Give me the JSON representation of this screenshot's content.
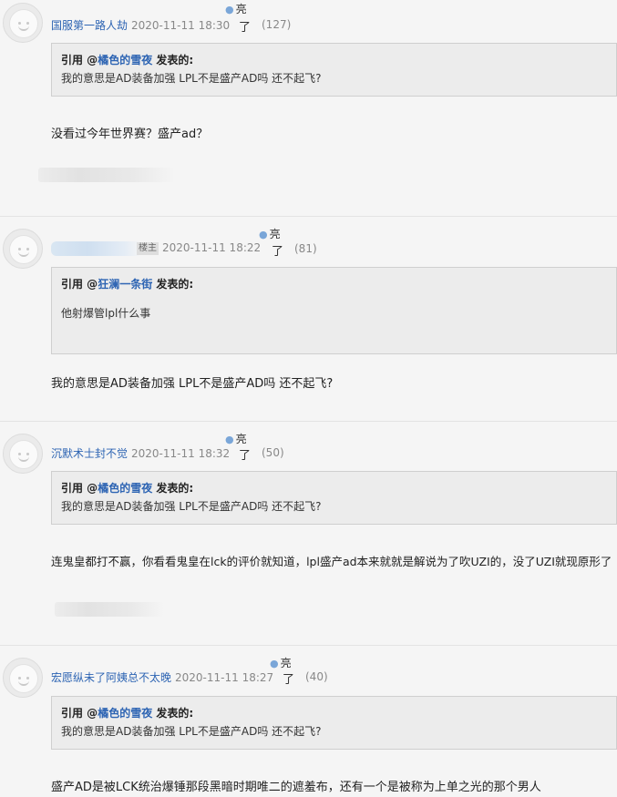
{
  "posts": [
    {
      "author": "国服第一路人劫",
      "time": "2020-11-11 18:30",
      "liang": "亮",
      "liao": "了",
      "count": "(127)",
      "quote": {
        "prefix": "引用 @",
        "user": "橘色的雪夜",
        "suffix": " 发表的:",
        "text": "我的意思是AD装备加强 LPL不是盛产AD吗 还不起飞?"
      },
      "content": "没看过今年世界赛？盛产ad？"
    },
    {
      "author": "",
      "badge": "楼主",
      "time": "2020-11-11 18:22",
      "liang": "亮",
      "liao": "了",
      "count": "(81)",
      "quote": {
        "prefix": "引用 @",
        "user": "狂澜一条街",
        "suffix": " 发表的:",
        "text": "他射爆管lpl什么事"
      },
      "content": "我的意思是AD装备加强 LPL不是盛产AD吗 还不起飞?"
    },
    {
      "author": "沉默术士封不觉",
      "time": "2020-11-11 18:32",
      "liang": "亮",
      "liao": "了",
      "count": "(50)",
      "quote": {
        "prefix": "引用 @",
        "user": "橘色的雪夜",
        "suffix": " 发表的:",
        "text": "我的意思是AD装备加强 LPL不是盛产AD吗 还不起飞?"
      },
      "content": "连鬼皇都打不赢，你看看鬼皇在lck的评价就知道，lpl盛产ad本来就就是解说为了吹UZI的，没了UZI就现原形了"
    },
    {
      "author": "宏愿纵未了阿姨总不太晚",
      "time": "2020-11-11 18:27",
      "liang": "亮",
      "liao": "了",
      "count": "(40)",
      "quote": {
        "prefix": "引用 @",
        "user": "橘色的雪夜",
        "suffix": " 发表的:",
        "text": "我的意思是AD装备加强 LPL不是盛产AD吗 还不起飞?"
      },
      "content": "盛产AD是被LCK统治爆锤那段黑暗时期唯二的遮羞布，还有一个是被称为上单之光的那个男人"
    }
  ],
  "icons": {
    "bulb": "lightbulb-icon",
    "avatar": "default-avatar-icon"
  },
  "colors": {
    "author_link": "#2d64b3",
    "quote_bg": "#ececec",
    "page_bg": "#f5f5f5"
  }
}
